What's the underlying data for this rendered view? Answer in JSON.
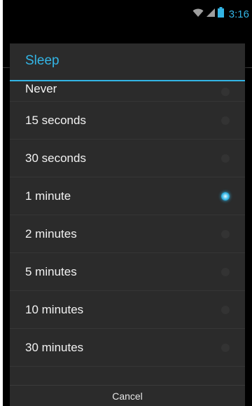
{
  "status_bar": {
    "time": "3:16",
    "icons": [
      "wifi-icon",
      "signal-icon",
      "battery-icon"
    ],
    "accent_color": "#33b5e5"
  },
  "dialog": {
    "title": "Sleep",
    "title_color": "#33b5e5",
    "background_color": "#2b2b2b",
    "options": [
      {
        "label": "Never",
        "selected": false
      },
      {
        "label": "15 seconds",
        "selected": false
      },
      {
        "label": "30 seconds",
        "selected": false
      },
      {
        "label": "1 minute",
        "selected": true
      },
      {
        "label": "2 minutes",
        "selected": false
      },
      {
        "label": "5 minutes",
        "selected": false
      },
      {
        "label": "10 minutes",
        "selected": false
      },
      {
        "label": "30 minutes",
        "selected": false
      }
    ],
    "cancel_label": "Cancel"
  }
}
